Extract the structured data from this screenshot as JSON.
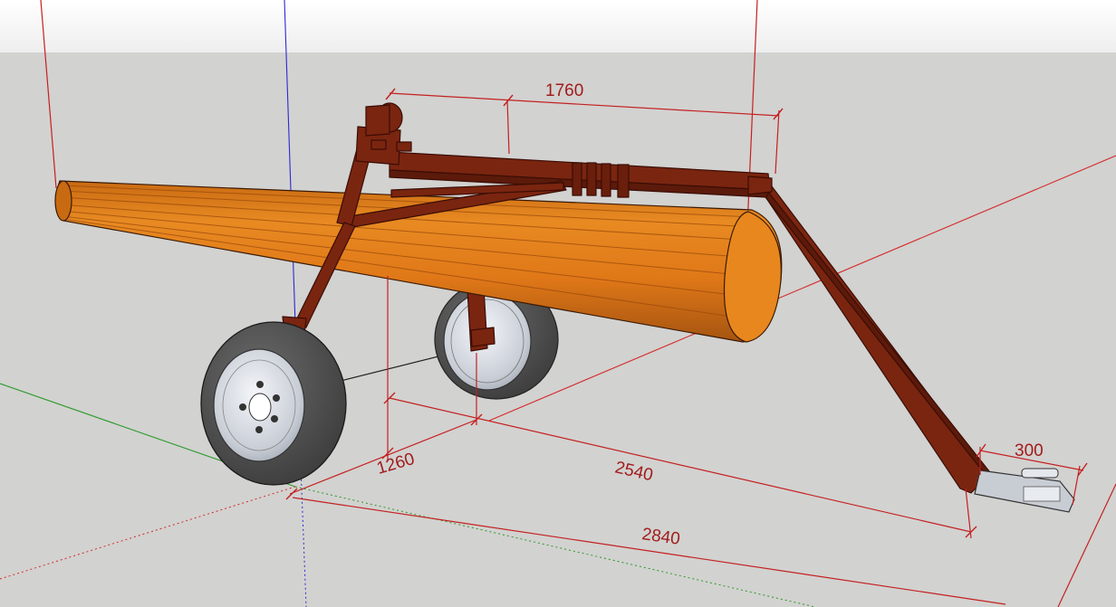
{
  "dimensions": {
    "top_span": "1760",
    "hitch_length": "300",
    "wheel_offset": "1260",
    "frame_length": "2540",
    "overall_length": "2840"
  },
  "colors": {
    "sky": "#ffffff",
    "ground": "#d2d2d0",
    "roller": "#e07818",
    "roller_dark": "#b85f10",
    "frame": "#7a2510",
    "tire": "#555555",
    "rim": "#d4d8df",
    "dimension": "#c42020",
    "axis_red": "#d42a2a",
    "axis_green": "#2a9a2a",
    "axis_blue": "#2a2ad4"
  }
}
